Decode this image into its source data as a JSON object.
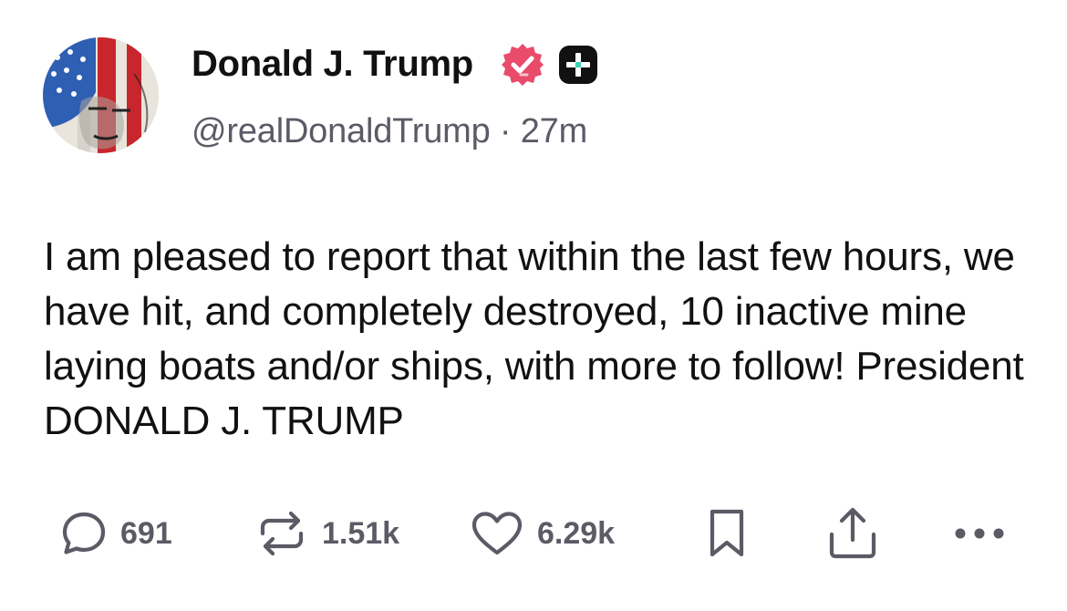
{
  "post": {
    "display_name": "Donald J. Trump",
    "handle": "@realDonaldTrump",
    "separator": "·",
    "time_ago": "27m",
    "text": "I am pleased to report that within the last few hours, we have hit, and completely destroyed, 10 inactive mine laying boats and/or ships, with more to follow! President DONALD J. TRUMP"
  },
  "icons": {
    "avatar": "user-avatar",
    "verified": "verified-badge-icon",
    "plus": "plus-badge-icon"
  },
  "actions": {
    "reply_count": "691",
    "repost_count": "1.51k",
    "like_count": "6.29k"
  },
  "colors": {
    "verified_badge": "#e94b6b",
    "muted_text": "#5b5b66",
    "primary_text": "#111111",
    "plus_badge_bg": "#111111",
    "plus_badge_accent": "#3fd3b8"
  }
}
